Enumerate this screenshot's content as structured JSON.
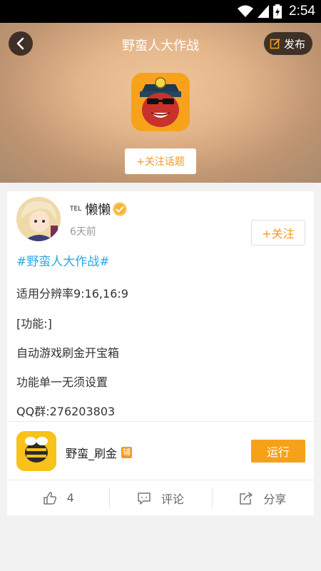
{
  "status_bar": {
    "time": "2:54"
  },
  "header": {
    "title": "野蛮人大作战",
    "publish_label": "发布"
  },
  "hero": {
    "follow_topic_label": "+关注话题"
  },
  "post": {
    "user": {
      "tel_mark": "TEL",
      "name": "懒懒",
      "time": "6天前"
    },
    "follow_label": "+关注",
    "topic_tag": "#野蛮人大作战#",
    "lines": [
      "适用分辨率9:16,16:9",
      "[功能:]",
      "自动游戏刷金开宝箱",
      "功能单一无须设置",
      "QQ群:276203803"
    ],
    "app": {
      "name": "野蛮_刷金",
      "badge": "辅",
      "run_label": "运行"
    },
    "actions": {
      "like_count": "4",
      "comment_label": "评论",
      "share_label": "分享"
    }
  },
  "colors": {
    "accent": "#f7a11a",
    "link": "#2aa8e6"
  }
}
